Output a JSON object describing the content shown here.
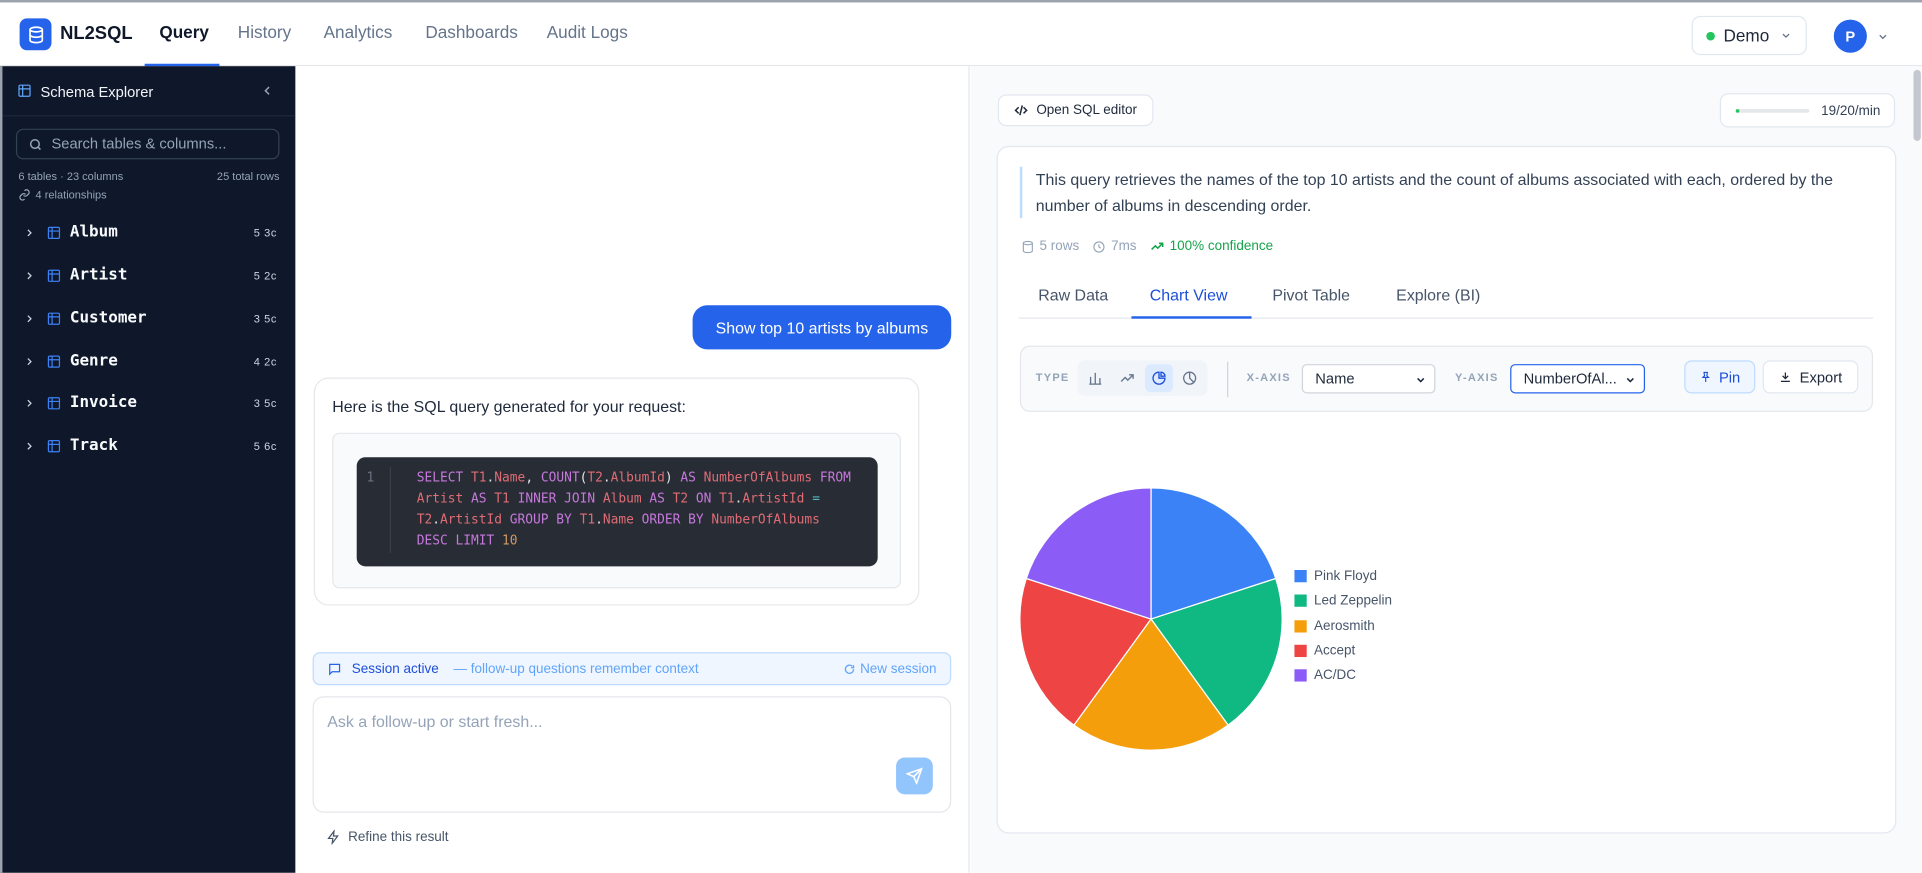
{
  "app": {
    "brand": "NL2SQL"
  },
  "nav": {
    "items": [
      "Query",
      "History",
      "Analytics",
      "Dashboards",
      "Audit Logs"
    ],
    "active": "Query"
  },
  "env": {
    "label": "Demo",
    "status_color": "#22c55e"
  },
  "user": {
    "initial": "P"
  },
  "sidebar": {
    "title": "Schema Explorer",
    "search_placeholder": "Search tables & columns...",
    "stats": "6 tables · 23 columns",
    "total_rows": "25 total rows",
    "relationships": "4 relationships",
    "tables": [
      {
        "name": "Album",
        "meta": "5 3c"
      },
      {
        "name": "Artist",
        "meta": "5 2c"
      },
      {
        "name": "Customer",
        "meta": "3 5c"
      },
      {
        "name": "Genre",
        "meta": "4 2c"
      },
      {
        "name": "Invoice",
        "meta": "3 5c"
      },
      {
        "name": "Track",
        "meta": "5 6c"
      }
    ]
  },
  "chat": {
    "user_message": "Show top 10 artists by albums",
    "answer_intro": "Here is the SQL query generated for your request:",
    "sql": "SELECT T1.Name, COUNT(T2.AlbumId) AS NumberOfAlbums FROM Artist AS T1 INNER JOIN Album AS T2 ON T1.ArtistId = T2.ArtistId GROUP BY T1.Name ORDER BY NumberOfAlbums DESC LIMIT 10",
    "line_number": "1",
    "session_label": "Session active",
    "session_note": "— follow-up questions remember context",
    "new_session": "New session",
    "composer_placeholder": "Ask a follow-up or start fresh...",
    "refine": "Refine this result"
  },
  "result": {
    "open_sql_editor": "Open SQL editor",
    "rate_limit": "19/20/min",
    "rate_fraction": 0.05,
    "description": "This query retrieves the names of the top 10 artists and the count of albums associated with each, ordered by the number of albums in descending order.",
    "rows": "5 rows",
    "time": "7ms",
    "confidence": "100% confidence",
    "tabs": [
      "Raw Data",
      "Chart View",
      "Pivot Table",
      "Explore (BI)"
    ],
    "active_tab": "Chart View",
    "toolbar": {
      "type_label": "TYPE",
      "x_label": "X-AXIS",
      "x_value": "Name",
      "y_label": "Y-AXIS",
      "y_value": "NumberOfAl...",
      "pin": "Pin",
      "export": "Export",
      "chart_types": [
        "bar-chart-icon",
        "line-chart-icon",
        "pie-chart-icon",
        "donut-chart-icon"
      ],
      "active_type": "pie-chart-icon"
    }
  },
  "chart_data": {
    "type": "pie",
    "categories": [
      "Pink Floyd",
      "Led Zeppelin",
      "Aerosmith",
      "Accept",
      "AC/DC"
    ],
    "values": [
      1,
      1,
      1,
      1,
      1
    ],
    "colors": [
      "#3b82f6",
      "#10b981",
      "#f59e0b",
      "#ef4444",
      "#8b5cf6"
    ],
    "legend_position": "right"
  }
}
